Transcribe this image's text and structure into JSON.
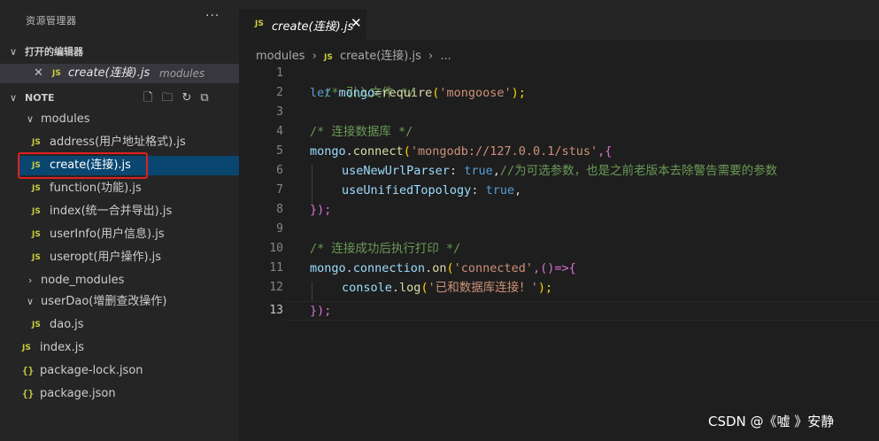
{
  "explorer": {
    "title": "资源管理器",
    "more": "···",
    "open_editors": {
      "label": "打开的编辑器",
      "items": [
        {
          "close": "✕",
          "icon": "JS",
          "name": "create(连接).js",
          "folder": "modules"
        }
      ]
    },
    "workspace": {
      "label": "NOTE",
      "actions": [
        "new-file-icon",
        "new-folder-icon",
        "refresh-icon",
        "collapse-all-icon"
      ],
      "tree": {
        "modules": {
          "label": "modules",
          "files": [
            {
              "icon": "JS",
              "name": "address(用户地址格式).js"
            },
            {
              "icon": "JS",
              "name": "create(连接).js"
            },
            {
              "icon": "JS",
              "name": "function(功能).js"
            },
            {
              "icon": "JS",
              "name": "index(统一合并导出).js"
            },
            {
              "icon": "JS",
              "name": "userInfo(用户信息).js"
            },
            {
              "icon": "JS",
              "name": "useropt(用户操作).js"
            }
          ]
        },
        "node_modules": {
          "label": "node_modules"
        },
        "userDao": {
          "label": "userDao(增删查改操作)",
          "files": [
            {
              "icon": "JS",
              "name": "dao.js"
            }
          ]
        },
        "root_files": [
          {
            "icon": "JS",
            "name": "index.js"
          },
          {
            "icon": "{}",
            "name": "package-lock.json"
          },
          {
            "icon": "{}",
            "name": "package.json"
          }
        ]
      }
    }
  },
  "editor": {
    "tab": {
      "icon": "JS",
      "name": "create(连接).js",
      "close": "✕"
    },
    "breadcrumb": {
      "folder": "modules",
      "sep": "›",
      "icon": "JS",
      "file": "create(连接).js",
      "more": "..."
    },
    "line_numbers": [
      "1",
      "2",
      "3",
      "4",
      "5",
      "6",
      "7",
      "8",
      "9",
      "10",
      "11",
      "12",
      "13"
    ],
    "active_line": "13",
    "code": {
      "l1": "/* 引入文件 */",
      "l2_kw": "let",
      "l2_var": " mongo",
      "l2_eq": "=",
      "l2_fn": "require",
      "l2_p1": "(",
      "l2_str": "'mongoose'",
      "l2_p2": ");",
      "l4": "/* 连接数据库 */",
      "l5_var": "mongo",
      "l5_dot": ".",
      "l5_fn": "connect",
      "l5_p1": "(",
      "l5_str": "'mongodb://127.0.0.1/stus'",
      "l5_p2": ",{",
      "l6_key": "useNewUrlParser",
      "l6_colon": ": ",
      "l6_val": "true",
      "l6_comma": ",",
      "l6_cmt": "//为可选参数，也是之前老版本去除警告需要的参数",
      "l7_key": "useUnifiedTopology",
      "l7_colon": ": ",
      "l7_val": "true",
      "l7_comma": ",",
      "l8": "});",
      "l10": "/* 连接成功后执行打印 */",
      "l11_var": "mongo",
      "l11_dot1": ".",
      "l11_var2": "connection",
      "l11_dot2": ".",
      "l11_fn": "on",
      "l11_p1": "(",
      "l11_str": "'connected'",
      "l11_p2": ",()=>{",
      "l12_var": "console",
      "l12_dot": ".",
      "l12_fn": "log",
      "l12_p1": "(",
      "l12_str": "'已和数据库连接！'",
      "l12_p2": ");",
      "l13": "});"
    }
  },
  "watermark": "CSDN @《嘘 》安静",
  "colors": {
    "sidebar_bg": "#252526",
    "editor_bg": "#1e1e1e",
    "selection": "#094771",
    "highlight_box": "#e02020",
    "js_icon": "#cbcb41"
  }
}
